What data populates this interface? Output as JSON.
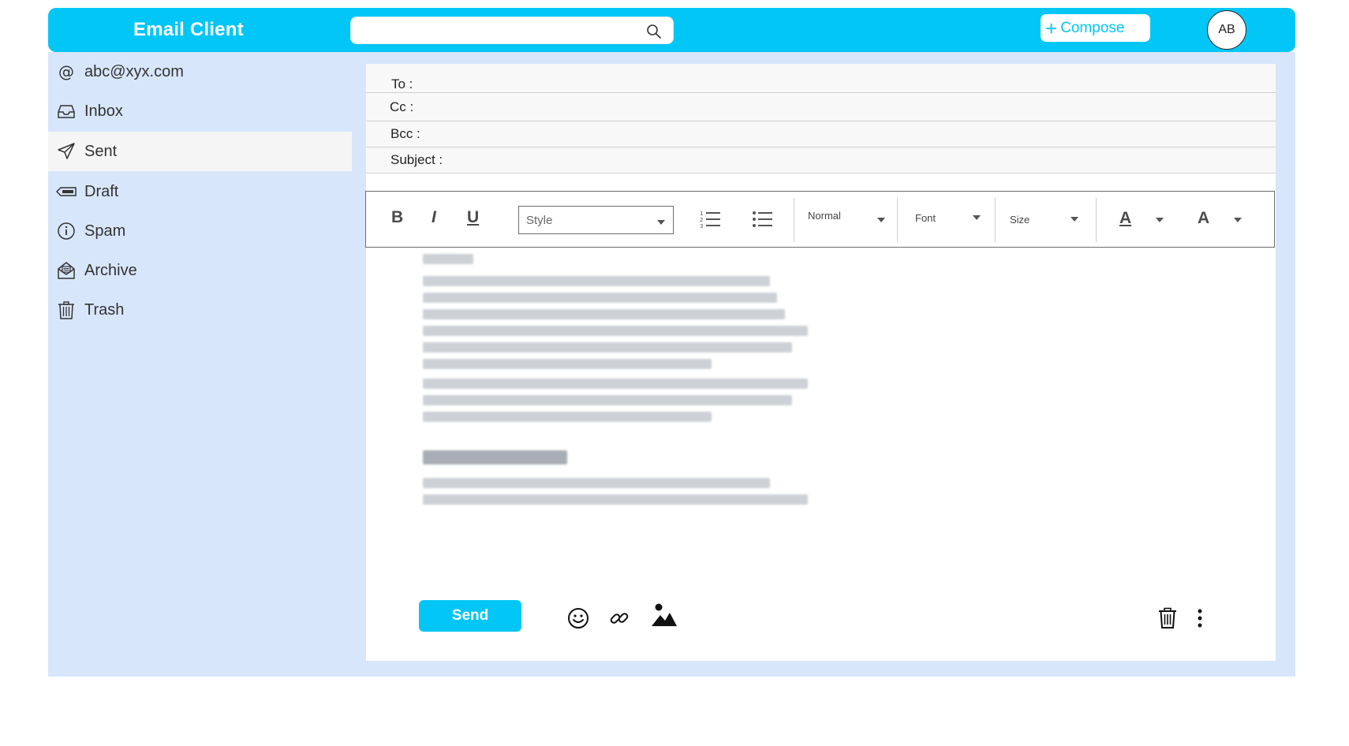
{
  "header": {
    "title": "Email Client",
    "search_placeholder": "",
    "compose_label": "Compose",
    "avatar_initials": "AB",
    "accent_color": "#02c6f6"
  },
  "sidebar": {
    "items": [
      {
        "label": "abc@xyx.com",
        "icon": "at-icon"
      },
      {
        "label": "Inbox",
        "icon": "inbox-icon"
      },
      {
        "label": "Sent",
        "icon": "send-icon",
        "active": true
      },
      {
        "label": "Draft",
        "icon": "draft-icon"
      },
      {
        "label": "Spam",
        "icon": "info-icon"
      },
      {
        "label": "Archive",
        "icon": "archive-icon"
      },
      {
        "label": "Trash",
        "icon": "trash-icon"
      }
    ]
  },
  "compose": {
    "to_label": "To :",
    "cc_label": "Cc :",
    "bcc_label": "Bcc :",
    "subject_label": "Subject :"
  },
  "toolbar": {
    "bold": "B",
    "italic": "I",
    "underline": "U",
    "style_placeholder": "Style",
    "paragraph_value": "Normal",
    "font_value": "Font",
    "size_value": "Size",
    "text_color_glyph": "A",
    "highlight_glyph": "A"
  },
  "actions": {
    "send_label": "Send"
  }
}
